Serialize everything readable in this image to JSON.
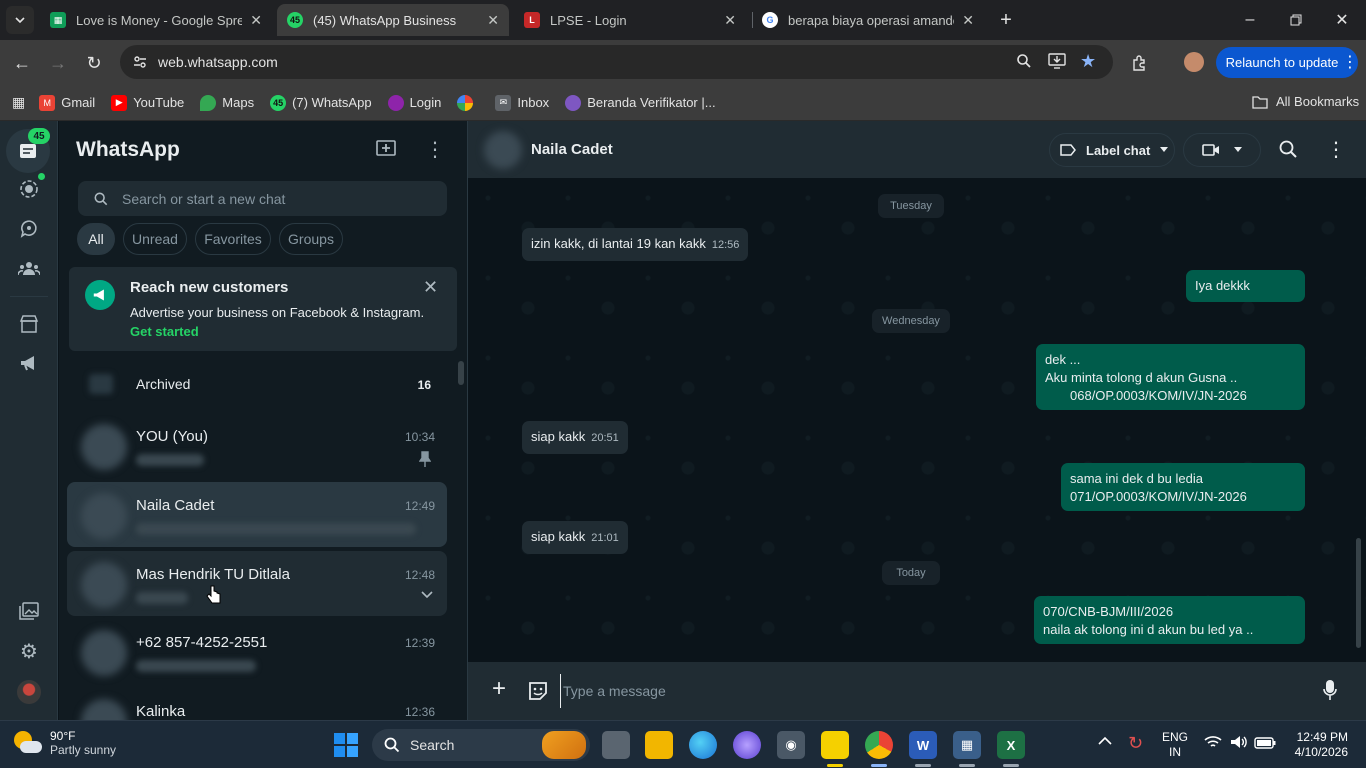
{
  "browser": {
    "tabs": [
      {
        "title": "Love is Money - Google Spread",
        "favicon_color": "#0f9d58",
        "favicon": "sheets-icon"
      },
      {
        "title": "(45) WhatsApp Business",
        "favicon_color": "#25d366",
        "favicon_badge": "45",
        "active": true
      },
      {
        "title": "LPSE - Login",
        "favicon_color": "#c62828",
        "favicon": "lpse-icon"
      },
      {
        "title": "berapa biaya operasi amandel -",
        "favicon_color": "#ffffff",
        "favicon": "google-icon"
      }
    ],
    "url": "web.whatsapp.com",
    "relaunch_label": "Relaunch to update",
    "bookmarks": [
      {
        "label": "Gmail",
        "color": "#ea4335"
      },
      {
        "label": "YouTube",
        "color": "#ff0000"
      },
      {
        "label": "Maps",
        "color": "#34a853"
      },
      {
        "label": "(7) WhatsApp",
        "color": "#25d366",
        "badge": "45"
      },
      {
        "label": "Login",
        "color": "#8e24aa"
      },
      {
        "label": "",
        "color": "#fbbc04"
      },
      {
        "label": "Inbox",
        "color": "#9aa0a6"
      },
      {
        "label": "Beranda Verifikator |...",
        "color": "#7e57c2"
      }
    ],
    "all_bookmarks_label": "All Bookmarks"
  },
  "sidebar_rail": {
    "chats_badge": "45"
  },
  "chat_list": {
    "title": "WhatsApp",
    "search_placeholder": "Search or start a new chat",
    "filters": [
      "All",
      "Unread",
      "Favorites",
      "Groups"
    ],
    "promo": {
      "title": "Reach new customers",
      "body": "Advertise your business on Facebook & Instagram.",
      "cta": "Get started"
    },
    "archived_label": "Archived",
    "archived_count": "16",
    "chats": [
      {
        "name": "YOU (You)",
        "time": "10:34",
        "pinned": true
      },
      {
        "name": "Naila Cadet",
        "time": "12:49",
        "selected": true
      },
      {
        "name": "Mas Hendrik TU Ditlala",
        "time": "12:48",
        "hovered": true
      },
      {
        "name": "+62 857-4252-2551",
        "time": "12:39"
      },
      {
        "name": "Kalinka",
        "time": "12:36"
      }
    ]
  },
  "conversation": {
    "contact_name": "Naila Cadet",
    "label_chat": "Label chat",
    "day_labels": {
      "tuesday": "Tuesday",
      "wednesday": "Wednesday",
      "today": "Today"
    },
    "messages": [
      {
        "dir": "in",
        "text": "izin kakk, di lantai 19 kan kakk",
        "time": "12:56"
      },
      {
        "dir": "out",
        "text": "Iya dekkk"
      },
      {
        "dir": "out",
        "lines": [
          "dek ...",
          "Aku minta tolong d akun Gusna ..",
          "068/OP.0003/KOM/IV/JN-2026"
        ]
      },
      {
        "dir": "in",
        "text": "siap kakk",
        "time": "20:51"
      },
      {
        "dir": "out",
        "lines": [
          "sama ini dek d bu ledia",
          "071/OP.0003/KOM/IV/JN-2026"
        ]
      },
      {
        "dir": "in",
        "text": "siap kakk",
        "time": "21:01"
      },
      {
        "dir": "out",
        "lines": [
          "070/CNB-BJM/III/2026",
          "naila ak tolong ini d akun bu led ya .."
        ]
      }
    ],
    "composer_placeholder": "Type a message"
  },
  "taskbar": {
    "weather_temp": "90°F",
    "weather_desc": "Partly sunny",
    "search_label": "Search",
    "lang_top": "ENG",
    "lang_bottom": "IN",
    "clock_time": "12:49 PM",
    "clock_date": "4/10/2026"
  }
}
